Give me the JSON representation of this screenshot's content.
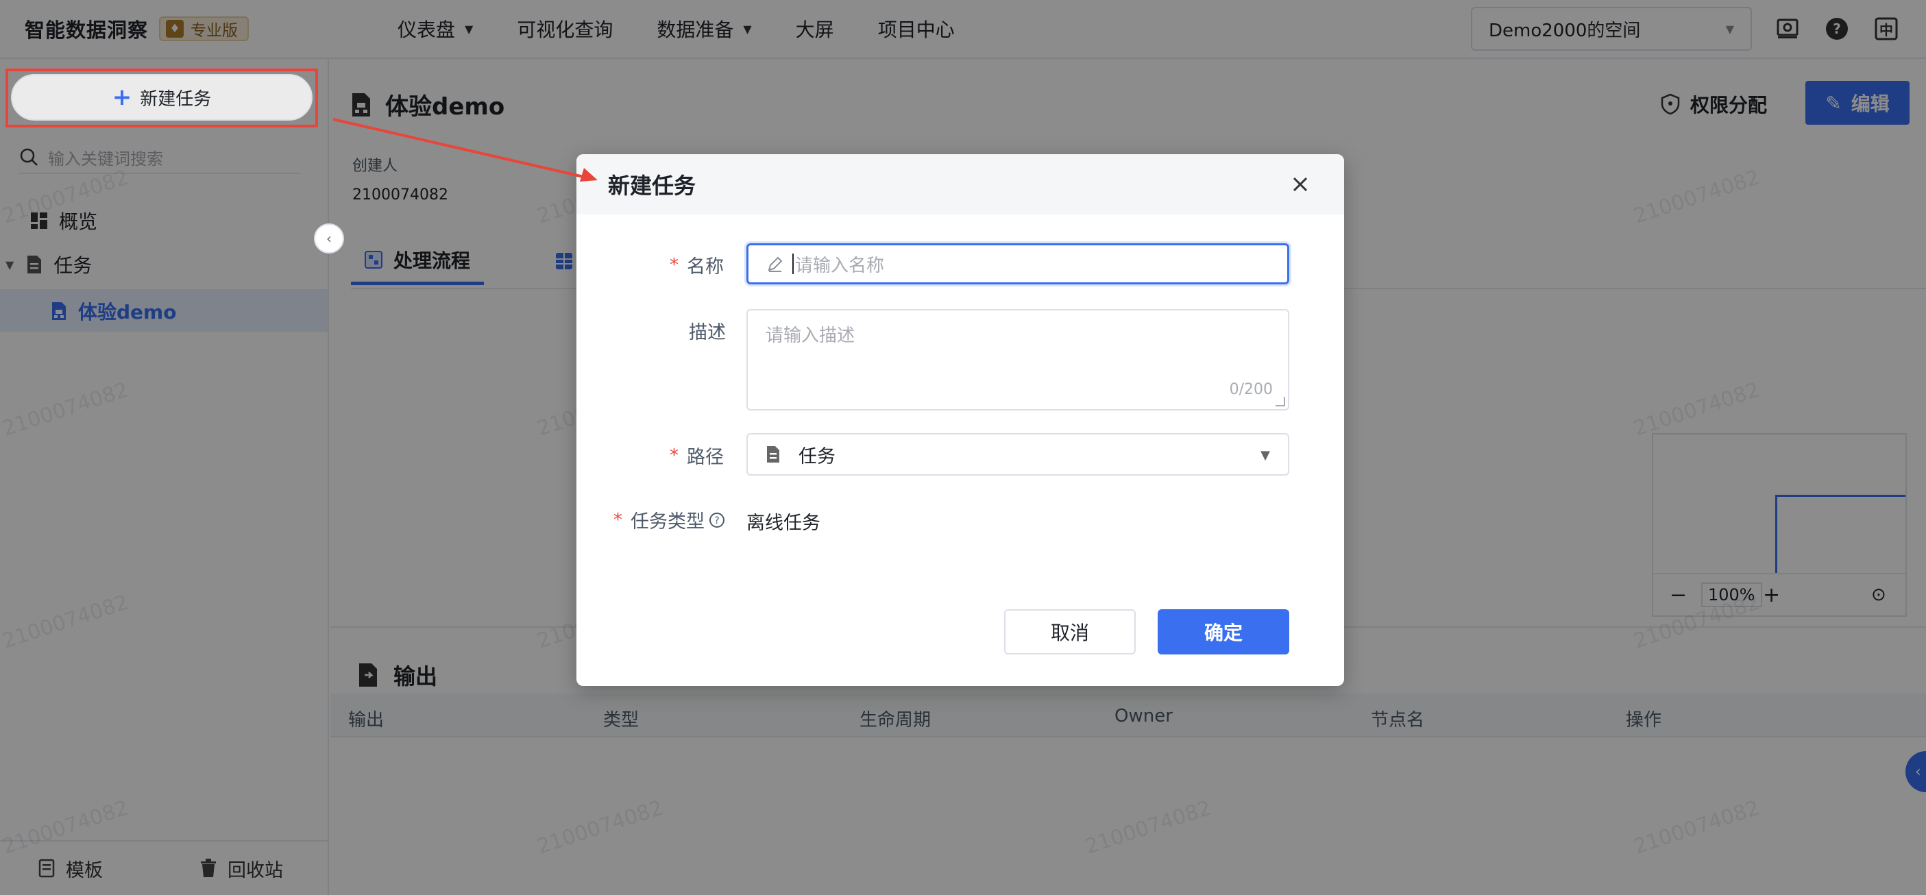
{
  "header": {
    "brand": "智能数据洞察",
    "edition": "专业版",
    "nav": [
      {
        "label": "仪表盘",
        "has_dropdown": true
      },
      {
        "label": "可视化查询",
        "has_dropdown": false
      },
      {
        "label": "数据准备",
        "has_dropdown": true
      },
      {
        "label": "大屏",
        "has_dropdown": false
      },
      {
        "label": "项目中心",
        "has_dropdown": false
      }
    ],
    "space": "Demo2000的空间",
    "icons": [
      "settings-icon",
      "help-icon",
      "language-icon"
    ],
    "language_label": "中"
  },
  "sidebar": {
    "new_task_label": "新建任务",
    "search_placeholder": "输入关键词搜索",
    "tree": {
      "overview": "概览",
      "tasks": "任务",
      "active_item": "体验demo"
    },
    "footer": {
      "templates": "模板",
      "recycle_bin": "回收站"
    }
  },
  "main": {
    "title": "体验demo",
    "creator_label": "创建人",
    "creator_value": "2100074082",
    "perm_label": "权限分配",
    "edit_label": "编辑",
    "tabs": [
      "处理流程"
    ],
    "minimap_zoom": "100%",
    "output": {
      "title": "输出",
      "columns": [
        "输出",
        "类型",
        "生命周期",
        "Owner",
        "节点名",
        "操作"
      ]
    },
    "watermark": "2100074082"
  },
  "modal": {
    "title": "新建任务",
    "name_label": "名称",
    "name_placeholder": "请输入名称",
    "desc_label": "描述",
    "desc_placeholder": "请输入描述",
    "desc_count": "0/200",
    "path_label": "路径",
    "path_value": "任务",
    "type_label": "任务类型",
    "type_value": "离线任务",
    "cancel_label": "取消",
    "confirm_label": "确定"
  },
  "colors": {
    "primary": "#3a6ff0",
    "annotation_red": "#e8463a",
    "active_bg": "#e6eeff"
  }
}
